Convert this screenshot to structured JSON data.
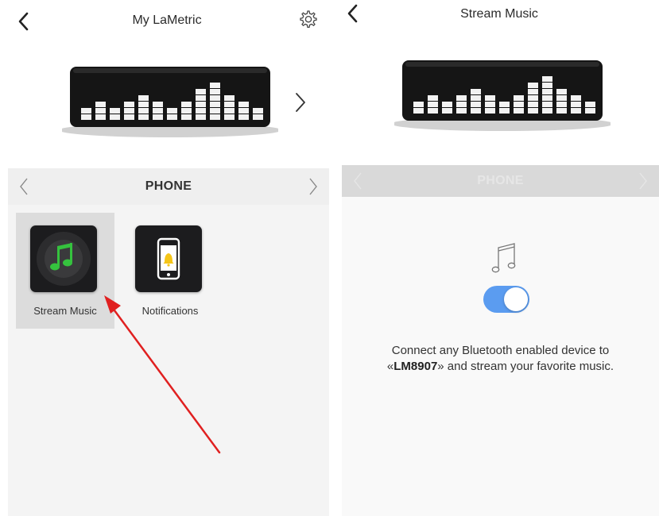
{
  "left_screen": {
    "title": "My LaMetric",
    "category": "PHONE",
    "apps": [
      {
        "label": "Stream Music",
        "icon": "music-note-icon",
        "selected": true
      },
      {
        "label": "Notifications",
        "icon": "phone-bell-icon",
        "selected": false
      }
    ]
  },
  "right_screen": {
    "title": "Stream Music",
    "category": "PHONE",
    "bluetooth_enabled": true,
    "description_prefix": "Connect any Bluetooth enabled device to",
    "open_quote": "«",
    "device_name": "LM8907",
    "close_quote": "»",
    "description_suffix": " and stream your favorite music."
  },
  "colors": {
    "toggle_on": "#5b9cf0",
    "annotation_arrow": "#e02020",
    "music_icon_green": "#35c23e",
    "bell_yellow": "#f5c518"
  }
}
